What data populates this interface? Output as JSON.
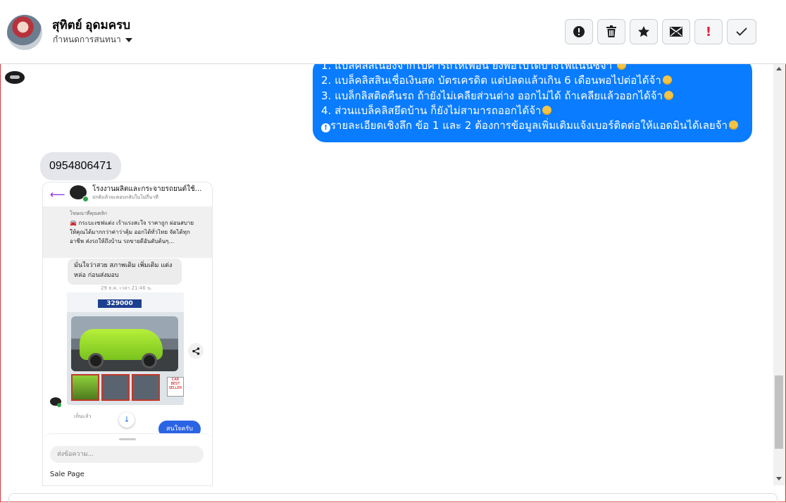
{
  "contact": {
    "name": "สุทิตย์ อุดมครบ",
    "subtitle": "กำหนดการสนทนา"
  },
  "toolbar": {
    "buttons": [
      "info-icon",
      "trash-icon",
      "star-icon",
      "mail-icon",
      "exclamation-icon",
      "check-icon"
    ],
    "red_exclamation": "!"
  },
  "messages": {
    "outgoing_lines": [
      "1. แบล็คลิสเนื่องจากไปค้ำรถให้เพื่อน ยังพอไปได้บางไฟแนนซ์จ้า",
      "2. แบล็คลิสสินเชื่อเงินสด บัตรเครดิต แต่ปลดแล้วเกิน 6 เดือนพอไปต่อได้จ้า",
      "3. แบล็กลิสติดคืนรถ ถ้ายังไม่เคลียส่วนต่าง ออกไม่ได้ ถ้าเคลียแล้วออกได้จ้า",
      "4. ส่วนแบล็คลิสยึดบ้าน ก็ยังไม่สามารถออกได้จ้า",
      "รายละเอียดเชิงลึก ข้อ 1 และ 2 ต้องการข้อมูลเพิ่มเติมแจ้งเบอร์ติดต่อให้แอดมินได้เลยจ้า"
    ],
    "incoming_phone": "0954806471"
  },
  "screenshot": {
    "page_name": "โรงงานผลิตและกระจายรถยนต์ใช้...",
    "page_status": "ปกติแล้วจะตอบกลับในไม่กี่นาที",
    "ad_label": "โฆษณาที่คุณคลิก",
    "ad_text": "🚘 กระบะเซฟแต่ง เร้าแรงสะใจ ราคาถูก ผ่อนสบาย ให้คุณได้มากกว่าค่าว่าคุ้ม ออกได้ทั่วไทย จัดได้ทุกอาชีพ ส่งรถให้ถึงบ้าน รถขายดีอันดับต้นๆ...",
    "grey_msg": "มั่นใจว่าสวย สภาพเดิม เพิ่มเติม แต่งหล่อ ก่อนส่งมอบ",
    "timestamp": "29 ธ.ค. เวลา 21:46 น.",
    "price": "329000",
    "best_seller": "CAR BEST SELLER",
    "seen": "เห็นแล้ว",
    "reply": "สนใจครับ",
    "compose_placeholder": "ส่งข้อความ...",
    "sale_page": "Sale Page"
  }
}
